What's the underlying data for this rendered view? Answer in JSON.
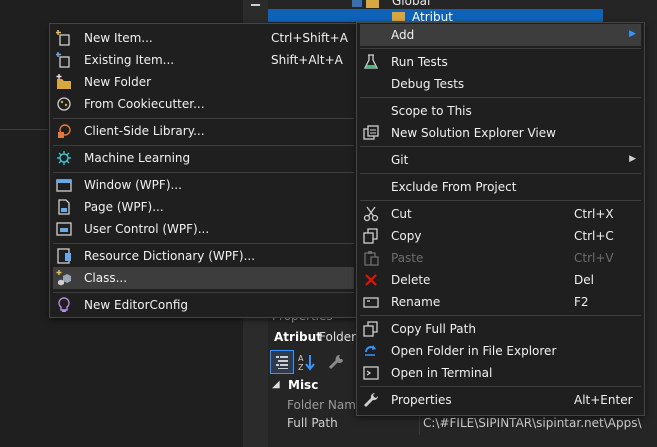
{
  "tree": {
    "global_label": "Global",
    "selected_label": "Atribut"
  },
  "properties": {
    "header": "Properties",
    "target": "Atribut",
    "kind": "Folder",
    "category": "Misc",
    "category_toggle": "◢",
    "rows": [
      {
        "name": "Folder Name",
        "value": ""
      },
      {
        "name": "Full Path",
        "value": "C:\\#FILE\\SIPINTAR\\sipintar.net\\Apps\\"
      }
    ]
  },
  "add_submenu": {
    "items": [
      {
        "label": "New Item...",
        "shortcut": "Ctrl+Shift+A",
        "icon": "new-item-icon"
      },
      {
        "label": "Existing Item...",
        "shortcut": "Shift+Alt+A",
        "icon": "existing-item-icon"
      },
      {
        "label": "New Folder",
        "shortcut": "",
        "icon": "new-folder-icon"
      },
      {
        "label": "From Cookiecutter...",
        "shortcut": "",
        "icon": "cookiecutter-icon"
      },
      {
        "label": "Client-Side Library...",
        "shortcut": "",
        "icon": "client-library-icon"
      },
      {
        "label": "Machine Learning",
        "shortcut": "",
        "icon": "machine-learning-icon"
      },
      {
        "label": "Window (WPF)...",
        "shortcut": "",
        "icon": "window-icon"
      },
      {
        "label": "Page (WPF)...",
        "shortcut": "",
        "icon": "page-icon"
      },
      {
        "label": "User Control (WPF)...",
        "shortcut": "",
        "icon": "user-control-icon"
      },
      {
        "label": "Resource Dictionary (WPF)...",
        "shortcut": "",
        "icon": "resource-dictionary-icon"
      },
      {
        "label": "Class...",
        "shortcut": "",
        "icon": "class-icon"
      },
      {
        "label": "New EditorConfig",
        "shortcut": "",
        "icon": "editorconfig-icon"
      }
    ]
  },
  "context_menu": {
    "items": [
      {
        "label": "Add",
        "shortcut": "",
        "submenu": true,
        "icon": ""
      },
      {
        "label": "Run Tests",
        "shortcut": "",
        "icon": "run-tests-icon"
      },
      {
        "label": "Debug Tests",
        "shortcut": "",
        "icon": ""
      },
      {
        "label": "Scope to This",
        "shortcut": "",
        "icon": ""
      },
      {
        "label": "New Solution Explorer View",
        "shortcut": "",
        "icon": "new-view-icon"
      },
      {
        "label": "Git",
        "shortcut": "",
        "submenu": true,
        "icon": ""
      },
      {
        "label": "Exclude From Project",
        "shortcut": "",
        "icon": ""
      },
      {
        "label": "Cut",
        "shortcut": "Ctrl+X",
        "icon": "cut-icon"
      },
      {
        "label": "Copy",
        "shortcut": "Ctrl+C",
        "icon": "copy-icon"
      },
      {
        "label": "Paste",
        "shortcut": "Ctrl+V",
        "disabled": true,
        "icon": "paste-icon"
      },
      {
        "label": "Delete",
        "shortcut": "Del",
        "icon": "delete-icon"
      },
      {
        "label": "Rename",
        "shortcut": "F2",
        "icon": "rename-icon"
      },
      {
        "label": "Copy Full Path",
        "shortcut": "",
        "icon": "copy-path-icon"
      },
      {
        "label": "Open Folder in File Explorer",
        "shortcut": "",
        "icon": "open-folder-icon"
      },
      {
        "label": "Open in Terminal",
        "shortcut": "",
        "icon": "terminal-icon"
      },
      {
        "label": "Properties",
        "shortcut": "Alt+Enter",
        "icon": "wrench-icon"
      }
    ]
  },
  "colors": {
    "accent": "#3794ff",
    "selection": "#0e63b8",
    "menu_bg": "#1f1f1f",
    "highlight": "#3d3d3d",
    "delete_red": "#e51400"
  }
}
